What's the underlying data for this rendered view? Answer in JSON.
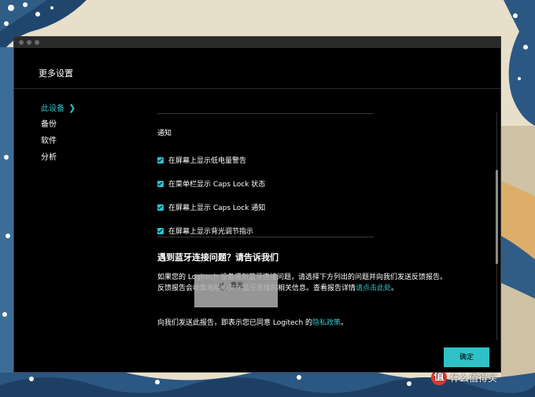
{
  "window": {
    "title": "更多设置"
  },
  "sidebar": {
    "items": [
      {
        "label": "此设备",
        "active": true
      },
      {
        "label": "备份",
        "active": false
      },
      {
        "label": "软件",
        "active": false
      },
      {
        "label": "分析",
        "active": false
      }
    ]
  },
  "notifications": {
    "heading": "通知",
    "options": [
      {
        "label": "在屏幕上显示低电量警告",
        "checked": true
      },
      {
        "label": "在菜单栏显示 Caps Lock 状态",
        "checked": true
      },
      {
        "label": "在屏幕上显示 Caps Lock 通知",
        "checked": true
      },
      {
        "label": "在屏幕上显示背光调节指示",
        "checked": true
      }
    ]
  },
  "bluetooth": {
    "title": "遇到蓝牙连接问题？请告诉我们",
    "body_line1": "如果您的 Logitech 设备遇到蓝牙连接问题，请选择下方列出的问题并向我们发送反馈报告。",
    "body_line2_prefix": "反馈报告会收集电脑中关于蓝牙连接的相关信息。查看报告详情",
    "details_link": "请点击此处",
    "body_line2_suffix": "。",
    "consent_prefix": "向我们发送此报告，即表示您已同意 Logitech 的",
    "privacy_link": "隐私政策",
    "consent_suffix": "。"
  },
  "tooltip": {
    "label": "背光",
    "icon": "spinner-icon"
  },
  "footer": {
    "ok_label": "确定"
  },
  "watermark": {
    "logo": "值",
    "text": "什么值得买"
  },
  "colors": {
    "accent": "#2ec2c8",
    "background": "#000000",
    "text": "#ffffff"
  }
}
